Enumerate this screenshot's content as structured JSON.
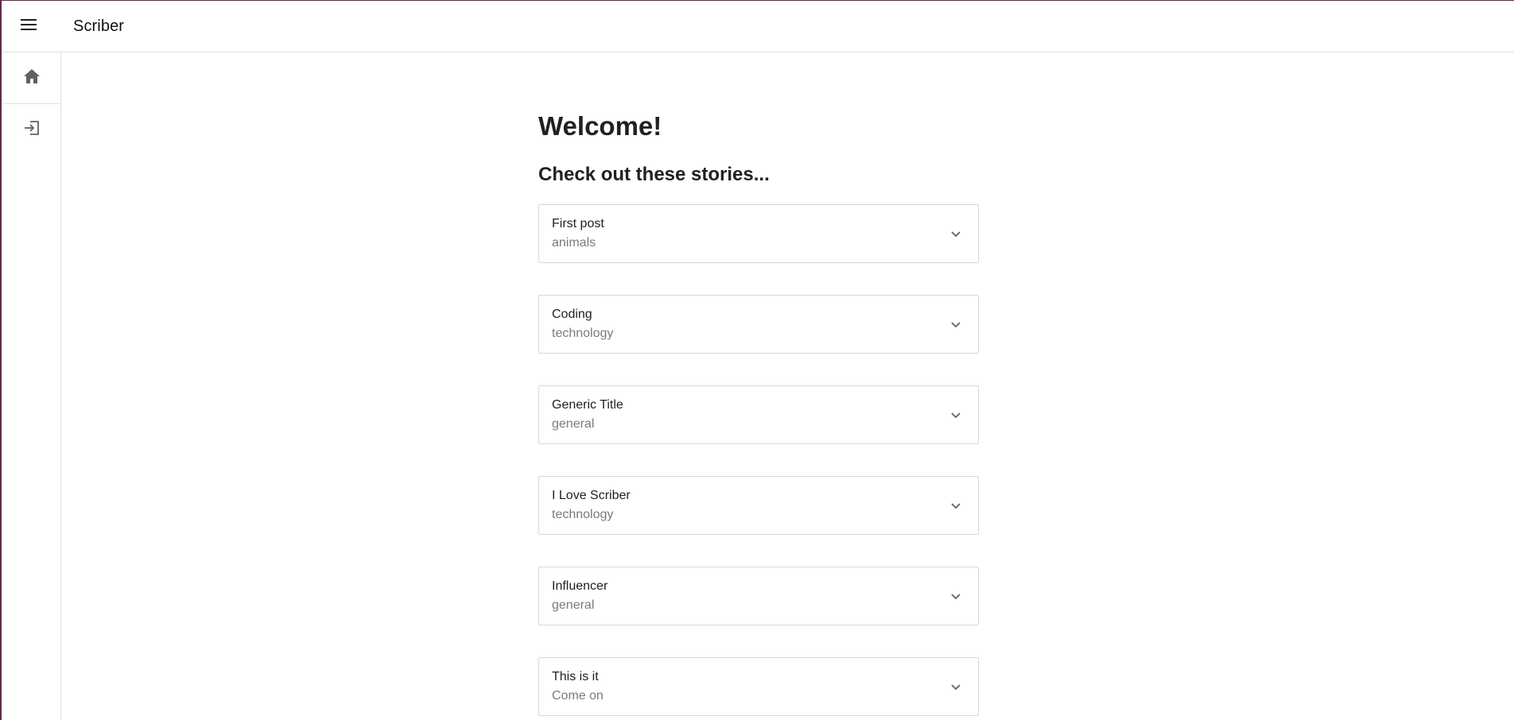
{
  "app": {
    "title": "Scriber"
  },
  "icons": {
    "menu": "menu-icon",
    "home": "home-icon",
    "login": "login-icon",
    "expand": "chevron-down-icon"
  },
  "colors": {
    "icon": "#616161",
    "border": "#e0e0e0",
    "secondary_text": "#7a7a7a"
  },
  "main": {
    "heading": "Welcome!",
    "subheading": "Check out these stories...",
    "stories": [
      {
        "title": "First post",
        "category": "animals"
      },
      {
        "title": "Coding",
        "category": "technology"
      },
      {
        "title": "Generic Title",
        "category": "general"
      },
      {
        "title": "I Love Scriber",
        "category": "technology"
      },
      {
        "title": "Influencer",
        "category": "general"
      },
      {
        "title": "This is it",
        "category": "Come on"
      }
    ]
  }
}
